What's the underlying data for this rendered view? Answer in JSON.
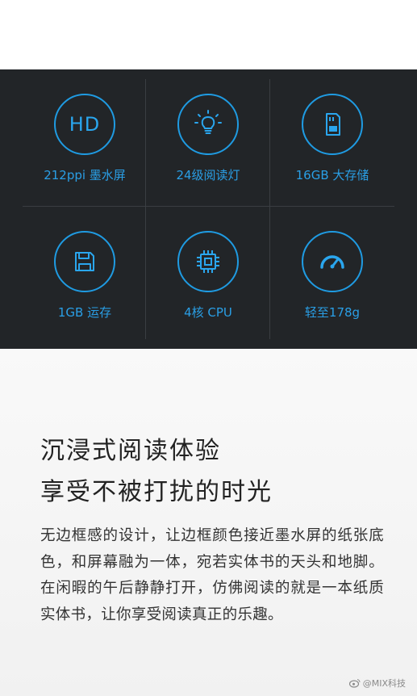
{
  "specs": [
    {
      "label": "212ppi 墨水屏",
      "icon": "hd-icon",
      "icon_text": "HD"
    },
    {
      "label": "24级阅读灯",
      "icon": "light-bulb-icon"
    },
    {
      "label": "16GB 大存储",
      "icon": "sd-card-icon"
    },
    {
      "label": "1GB 运存",
      "icon": "floppy-disk-icon"
    },
    {
      "label": "4核 CPU",
      "icon": "cpu-chip-icon"
    },
    {
      "label": "轻至178g",
      "icon": "speedometer-icon"
    }
  ],
  "headline": {
    "line1": "沉浸式阅读体验",
    "line2": "享受不被打扰的时光"
  },
  "paragraph": "无边框感的设计，让边框颜色接近墨水屏的纸张底色，和屏幕融为一体，宛若实体书的天头和地脚。在闲暇的午后静静打开，仿佛阅读的就是一本纸质实体书，让你享受阅读真正的乐趣。",
  "watermark": "@MIX科技",
  "colors": {
    "panel_bg": "#222528",
    "accent_blue": "#1f9be2",
    "divider": "#3a3e42"
  }
}
